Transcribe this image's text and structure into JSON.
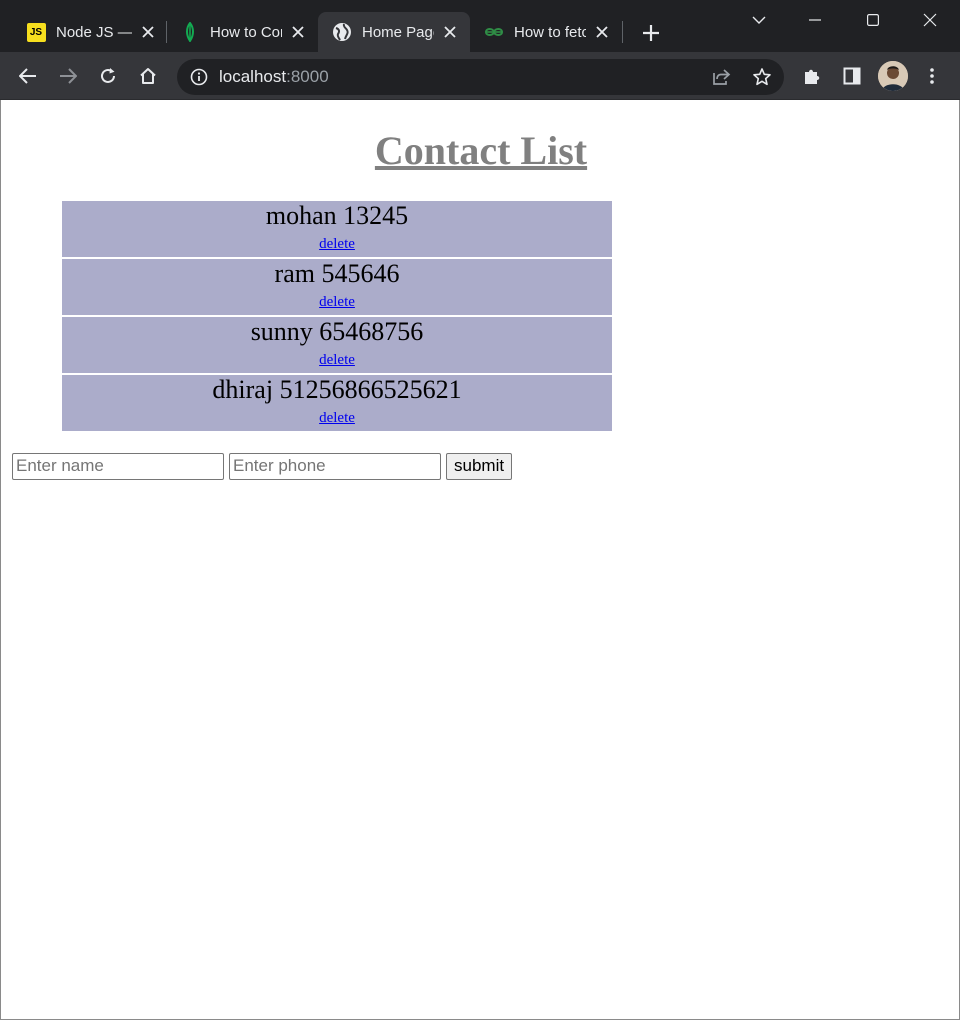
{
  "browser": {
    "tabs": [
      {
        "title": "Node JS — ",
        "favicon": "js-icon",
        "active": false
      },
      {
        "title": "How to Con",
        "favicon": "mongodb-icon",
        "active": false
      },
      {
        "title": "Home Page",
        "favicon": "globe-icon",
        "active": true
      },
      {
        "title": "How to fetc",
        "favicon": "geeksforgeeks-icon",
        "active": false
      }
    ],
    "js_favicon_text": "JS",
    "address": {
      "host": "localhost",
      "port": ":8000"
    },
    "colors": {
      "tabstrip": "#202124",
      "toolbar": "#35363a",
      "text": "#e8eaed"
    }
  },
  "page": {
    "title": "Contact List",
    "contacts": [
      {
        "text": "mohan 13245",
        "delete_label": "delete"
      },
      {
        "text": "ram 545646",
        "delete_label": "delete"
      },
      {
        "text": "sunny 65468756",
        "delete_label": "delete"
      },
      {
        "text": "dhiraj 51256866525621",
        "delete_label": "delete"
      }
    ],
    "form": {
      "name_placeholder": "Enter name",
      "phone_placeholder": "Enter phone",
      "submit_label": "submit"
    },
    "colors": {
      "title": "#808080",
      "contact_bg": "#abacca",
      "link": "#0000ee"
    }
  }
}
